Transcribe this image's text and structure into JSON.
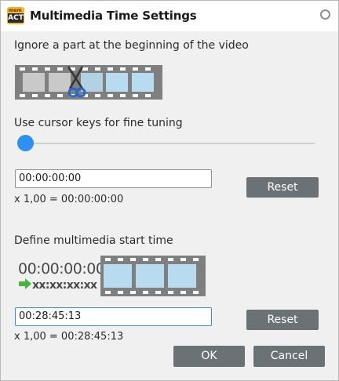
{
  "window": {
    "title": "Multimedia Time Settings",
    "app_icon_text_top": "mem",
    "app_icon_text_bottom": "ACT"
  },
  "section1": {
    "label": "Ignore a part at the beginning of the video",
    "hint": "Use cursor keys for fine tuning",
    "slider_value": 0,
    "time_input_value": "00:00:00:00",
    "reset_label": "Reset",
    "scale_text": "x 1,00 = 00:00:00:00"
  },
  "section2": {
    "label": "Define multimedia start time",
    "timecode_display": "00:00:00:00",
    "timecode_placeholder": "xx:xx:xx:xx",
    "time_input_value": "00:28:45:13",
    "reset_label": "Reset",
    "scale_text": "x 1,00 = 00:28:45:13"
  },
  "footer": {
    "ok_label": "OK",
    "cancel_label": "Cancel"
  },
  "colors": {
    "accent": "#2f8ff3",
    "button": "#6b7276",
    "film_frame": "#b8dcef",
    "film_strip": "#7f7f7f",
    "arrow": "#44b53d"
  }
}
